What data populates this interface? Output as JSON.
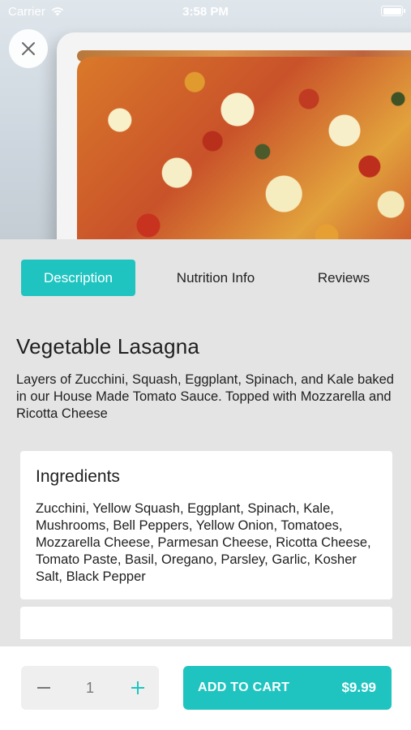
{
  "status_bar": {
    "carrier": "Carrier",
    "time": "3:58 PM"
  },
  "hero": {
    "icon": "close-icon"
  },
  "tabs": [
    {
      "label": "Description",
      "active": true
    },
    {
      "label": "Nutrition Info",
      "active": false
    },
    {
      "label": "Reviews",
      "active": false
    }
  ],
  "product": {
    "title": "Vegetable Lasagna",
    "description": "Layers of Zucchini, Squash, Eggplant, Spinach, and Kale baked in our House Made Tomato Sauce. Topped with Mozzarella and Ricotta Cheese"
  },
  "ingredients": {
    "title": "Ingredients",
    "text": "Zucchini, Yellow Squash, Eggplant, Spinach, Kale, Mushrooms, Bell Peppers, Yellow Onion, Tomatoes, Mozzarella Cheese, Parmesan Cheese, Ricotta Cheese, Tomato Paste, Basil, Oregano, Parsley, Garlic, Kosher Salt, Black Pepper"
  },
  "cart": {
    "quantity": "1",
    "add_label": "ADD TO CART",
    "price": "$9.99"
  },
  "colors": {
    "accent": "#1fc4c1",
    "background": "#e4e4e4"
  }
}
